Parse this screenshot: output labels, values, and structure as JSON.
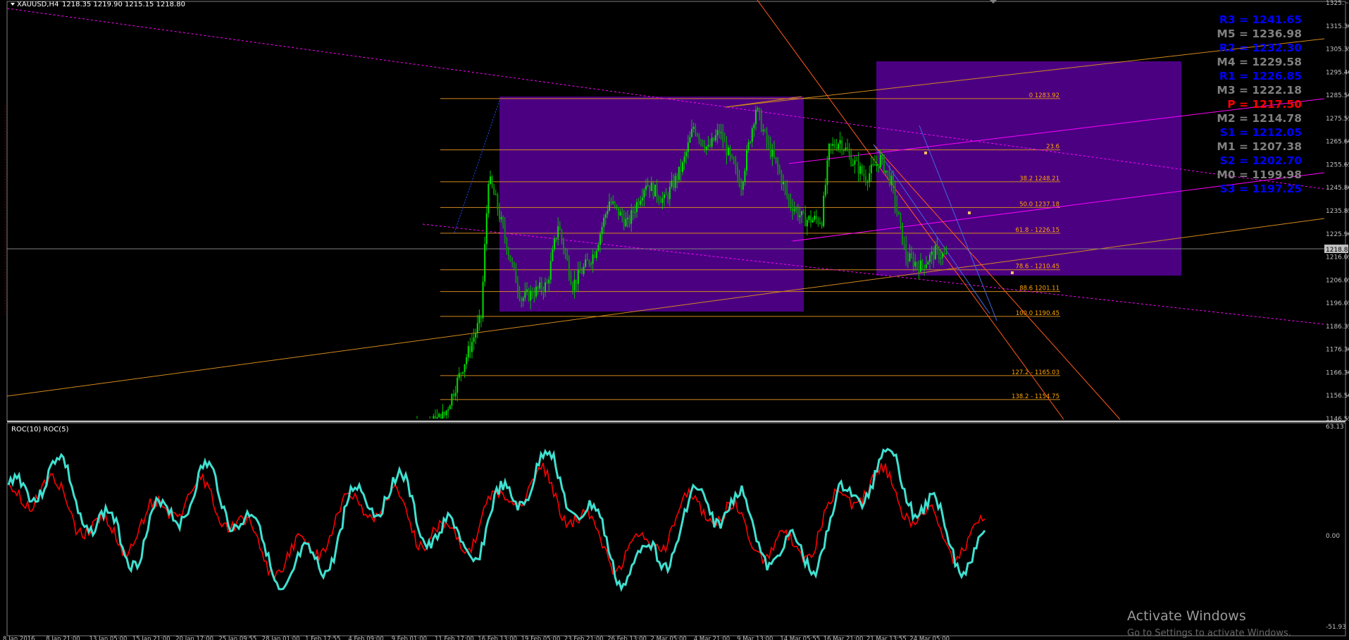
{
  "header": {
    "symbol": "XAUUSD,H4",
    "ohlc": "1218.35 1219.90 1215.15 1218.80"
  },
  "price_axis": {
    "ticks": [
      "1325.",
      "1315.30",
      "1305.35",
      "1295.40",
      "1285.50",
      "1275.55",
      "1265.60",
      "1255.65",
      "1245.80",
      "1235.85",
      "1225.90",
      "1216.05",
      "1206.05",
      "1196.05",
      "1186.35",
      "1176.30",
      "1166.30",
      "1156.50",
      "1146.55"
    ],
    "current_price": "1218.80"
  },
  "time_axis": {
    "labels": [
      "8 Jan 2016",
      "8 Jan 21:00",
      "13 Jan 05:00",
      "15 Jan 21:00",
      "20 Jan 17:00",
      "25 Jan 09:55",
      "28 Jan 01:00",
      "1 Feb 17:55",
      "4 Feb 09:00",
      "9 Feb 01:00",
      "11 Feb 17:00",
      "16 Feb 13:00",
      "19 Feb 05:00",
      "23 Feb 21:00",
      "26 Feb 13:00",
      "2 Mar 05:00",
      "4 Mar 21:00",
      "9 Mar 13:00",
      "14 Mar 05:55",
      "16 Mar 21:00",
      "21 Mar 13:55",
      "24 Mar 05:00"
    ]
  },
  "fibonacci": [
    {
      "label": "0 1283.92",
      "price": 1283.92
    },
    {
      "label": "23.6",
      "price": 1261.9
    },
    {
      "label": "38.2 1248.21",
      "price": 1248.21
    },
    {
      "label": "50.0 1237.18",
      "price": 1237.18
    },
    {
      "label": "61.8 - 1226.15",
      "price": 1226.15
    },
    {
      "label": "78.6 - 1210.45",
      "price": 1210.45
    },
    {
      "label": "88.6 1201.11",
      "price": 1201.11
    },
    {
      "label": "100.0 1190.45",
      "price": 1190.45
    },
    {
      "label": "127.2 - 1165.03",
      "price": 1165.03
    },
    {
      "label": "138.2 - 1154.75",
      "price": 1154.75
    }
  ],
  "pivots": [
    {
      "label": "R3 = 1241.65",
      "color": "#0000ff"
    },
    {
      "label": "M5 = 1236.98",
      "color": "#808080"
    },
    {
      "label": "R2 = 1232.30",
      "color": "#0000ff"
    },
    {
      "label": "M4 = 1229.58",
      "color": "#808080"
    },
    {
      "label": "R1 = 1226.85",
      "color": "#0000ff"
    },
    {
      "label": "M3 = 1222.18",
      "color": "#808080"
    },
    {
      "label": "P  = 1217.50",
      "color": "#ff0000"
    },
    {
      "label": "M2 = 1214.78",
      "color": "#808080"
    },
    {
      "label": "S1 = 1212.05",
      "color": "#0000ff"
    },
    {
      "label": "M1 = 1207.38",
      "color": "#808080"
    },
    {
      "label": "S2 = 1202.70",
      "color": "#0000ff"
    },
    {
      "label": "M0 = 1199.98",
      "color": "#808080"
    },
    {
      "label": "S3 = 1197.25",
      "color": "#0000ff"
    }
  ],
  "indicator": {
    "title": "ROC(10)  ROC(5)",
    "ticks": [
      "63.13",
      "0.00",
      "-51.93"
    ]
  },
  "watermark": {
    "line1": "Activate Windows",
    "line2": "Go to Settings to activate Windows."
  },
  "colors": {
    "background": "#000000",
    "candle": "#00c000",
    "zone": "#4b0082",
    "fib": "#d2891e",
    "roc10": "#ff0000",
    "roc5": "#40e0d0",
    "magenta": "#ff00ff"
  },
  "chart_data": {
    "type": "line",
    "title": "XAUUSD,H4",
    "series": [
      {
        "name": "ROC(10)",
        "values": []
      },
      {
        "name": "ROC(5)",
        "values": []
      }
    ],
    "price_path": [
      [
        0,
        1130
      ],
      [
        40,
        1148
      ],
      [
        60,
        1190
      ],
      [
        64,
        1250
      ],
      [
        68,
        1240
      ],
      [
        76,
        1215
      ],
      [
        82,
        1198
      ],
      [
        96,
        1204
      ],
      [
        102,
        1230
      ],
      [
        110,
        1204
      ],
      [
        122,
        1218
      ],
      [
        130,
        1240
      ],
      [
        140,
        1230
      ],
      [
        150,
        1248
      ],
      [
        160,
        1240
      ],
      [
        170,
        1255
      ],
      [
        176,
        1272
      ],
      [
        184,
        1262
      ],
      [
        190,
        1270
      ],
      [
        196,
        1258
      ],
      [
        202,
        1247
      ],
      [
        210,
        1280
      ],
      [
        216,
        1265
      ],
      [
        222,
        1254
      ],
      [
        228,
        1240
      ],
      [
        236,
        1232
      ],
      [
        246,
        1232
      ],
      [
        250,
        1262
      ],
      [
        256,
        1266
      ],
      [
        262,
        1258
      ],
      [
        270,
        1250
      ],
      [
        278,
        1258
      ],
      [
        284,
        1248
      ],
      [
        292,
        1216
      ],
      [
        300,
        1212
      ],
      [
        308,
        1218
      ],
      [
        314,
        1216
      ]
    ]
  }
}
